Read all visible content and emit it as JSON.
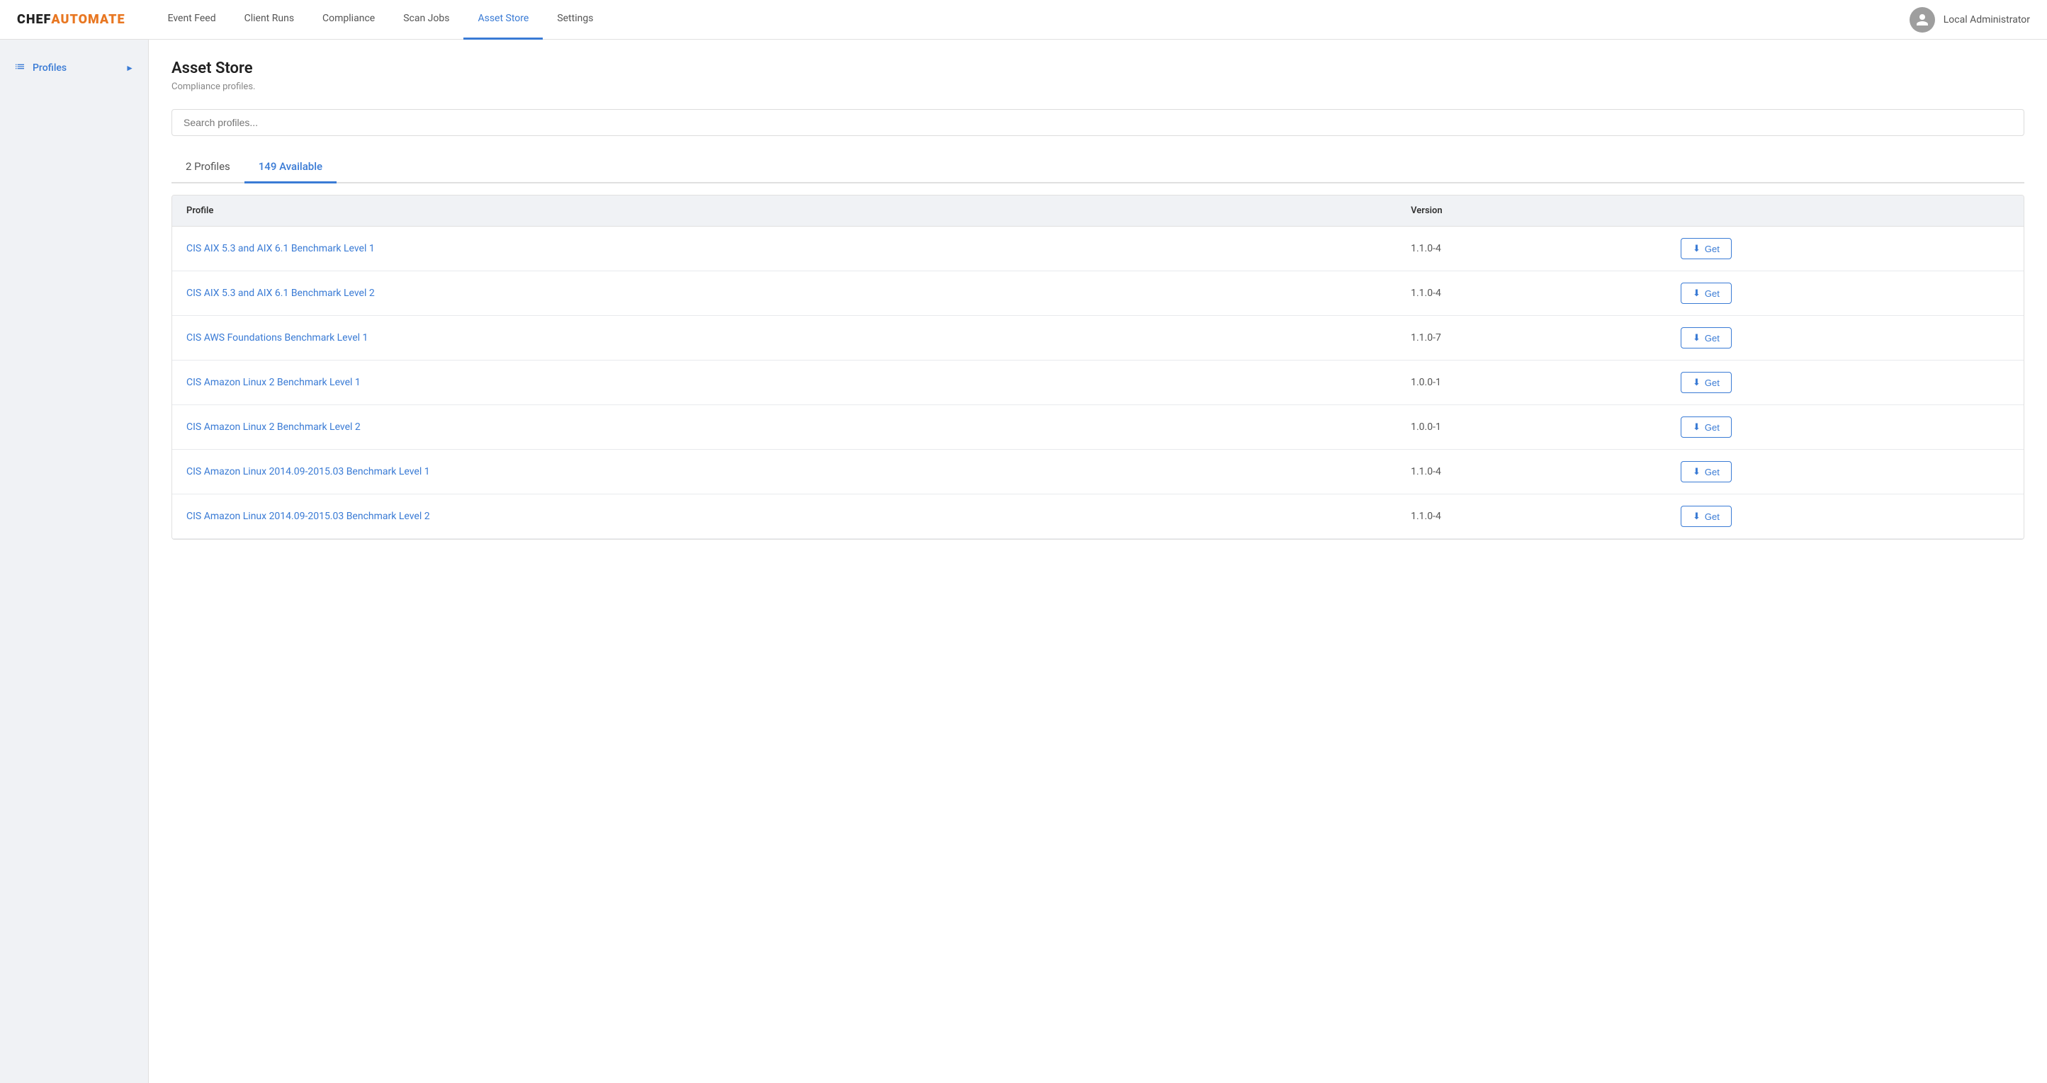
{
  "brand": {
    "chef": "CHEF",
    "automate": "AUTOMATE"
  },
  "nav": {
    "links": [
      {
        "id": "event-feed",
        "label": "Event Feed",
        "active": false
      },
      {
        "id": "client-runs",
        "label": "Client Runs",
        "active": false
      },
      {
        "id": "compliance",
        "label": "Compliance",
        "active": false
      },
      {
        "id": "scan-jobs",
        "label": "Scan Jobs",
        "active": false
      },
      {
        "id": "asset-store",
        "label": "Asset Store",
        "active": true
      },
      {
        "id": "settings",
        "label": "Settings",
        "active": false
      }
    ],
    "user_name": "Local Administrator"
  },
  "sidebar": {
    "items": [
      {
        "id": "profiles",
        "label": "Profiles",
        "icon": "list-icon"
      }
    ]
  },
  "main": {
    "title": "Asset Store",
    "subtitle": "Compliance profiles.",
    "search_placeholder": "Search profiles...",
    "tabs": [
      {
        "id": "my-profiles",
        "label": "2 Profiles",
        "active": false
      },
      {
        "id": "available",
        "label": "149 Available",
        "active": true
      }
    ],
    "table": {
      "headers": [
        {
          "id": "profile",
          "label": "Profile"
        },
        {
          "id": "version",
          "label": "Version"
        },
        {
          "id": "action",
          "label": ""
        }
      ],
      "rows": [
        {
          "id": "row-1",
          "profile": "CIS AIX 5.3 and AIX 6.1 Benchmark Level 1",
          "version": "1.1.0-4",
          "action": "Get"
        },
        {
          "id": "row-2",
          "profile": "CIS AIX 5.3 and AIX 6.1 Benchmark Level 2",
          "version": "1.1.0-4",
          "action": "Get"
        },
        {
          "id": "row-3",
          "profile": "CIS AWS Foundations Benchmark Level 1",
          "version": "1.1.0-7",
          "action": "Get"
        },
        {
          "id": "row-4",
          "profile": "CIS Amazon Linux 2 Benchmark Level 1",
          "version": "1.0.0-1",
          "action": "Get"
        },
        {
          "id": "row-5",
          "profile": "CIS Amazon Linux 2 Benchmark Level 2",
          "version": "1.0.0-1",
          "action": "Get"
        },
        {
          "id": "row-6",
          "profile": "CIS Amazon Linux 2014.09-2015.03 Benchmark Level 1",
          "version": "1.1.0-4",
          "action": "Get"
        },
        {
          "id": "row-7",
          "profile": "CIS Amazon Linux 2014.09-2015.03 Benchmark Level 2",
          "version": "1.1.0-4",
          "action": "Get"
        }
      ]
    },
    "get_button_label": "Get"
  }
}
